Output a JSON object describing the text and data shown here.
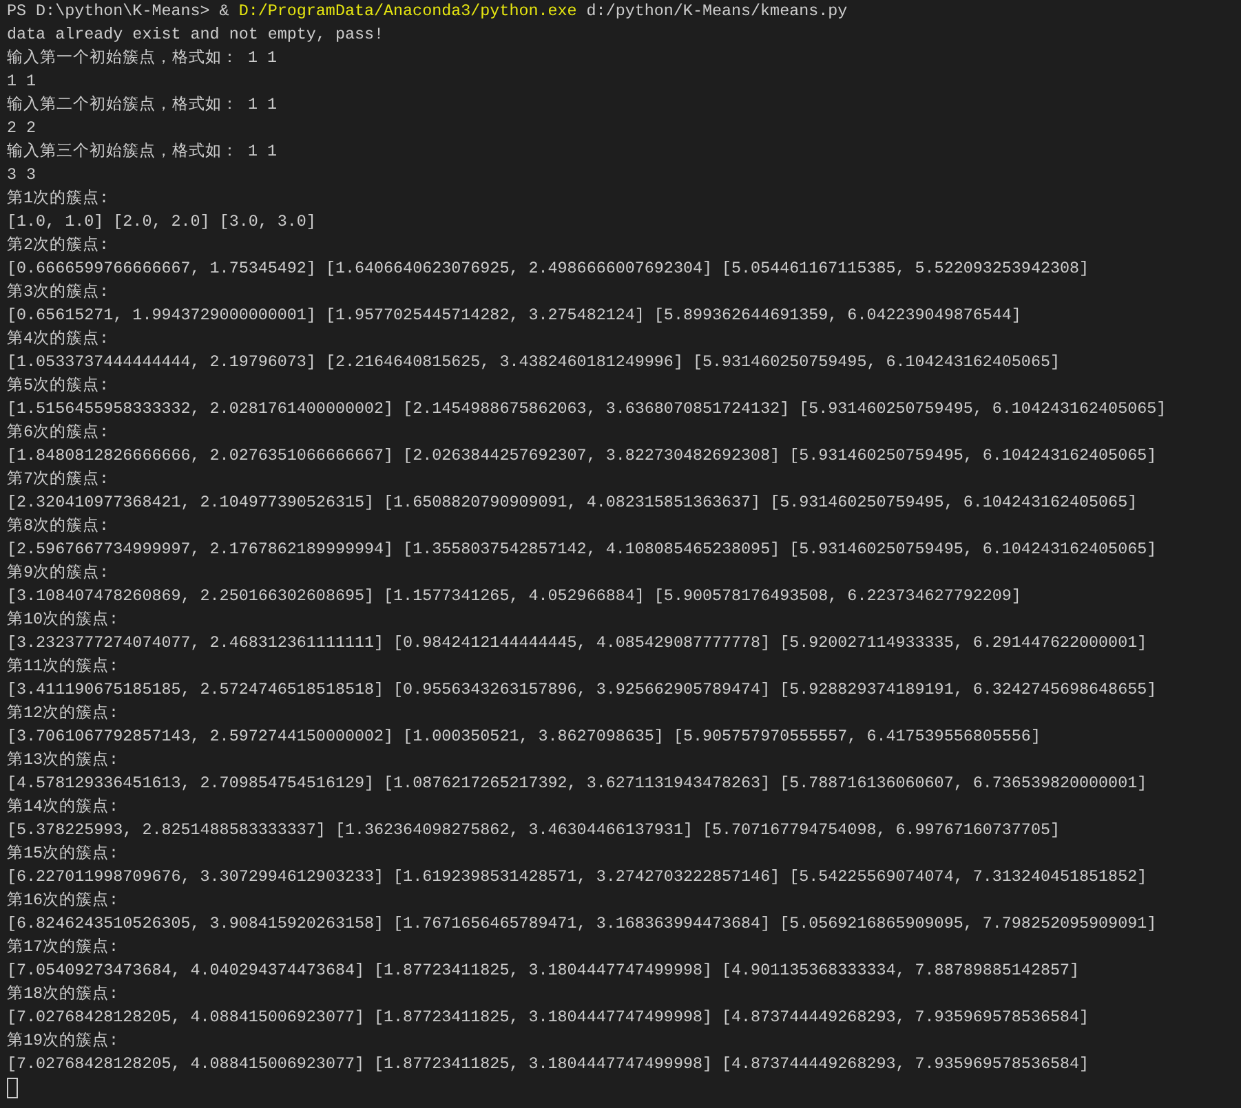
{
  "terminal": {
    "command": {
      "prompt": "PS D:\\python\\K-Means>",
      "operator": "&",
      "program": "D:/ProgramData/Anaconda3/python.exe",
      "argument": "d:/python/K-Means/kmeans.py"
    },
    "lines": [
      "data already exist and not empty, pass!",
      "输入第一个初始簇点，格式如： 1 1",
      "1 1",
      "输入第二个初始簇点，格式如： 1 1",
      "2 2",
      "输入第三个初始簇点，格式如： 1 1",
      "3 3",
      "第1次的簇点:",
      "[1.0, 1.0] [2.0, 2.0] [3.0, 3.0]",
      "第2次的簇点:",
      "[0.6666599766666667, 1.75345492] [1.6406640623076925, 2.4986666007692304] [5.054461167115385, 5.522093253942308]",
      "第3次的簇点:",
      "[0.65615271, 1.9943729000000001] [1.9577025445714282, 3.275482124] [5.899362644691359, 6.042239049876544]",
      "第4次的簇点:",
      "[1.0533737444444444, 2.19796073] [2.2164640815625, 3.4382460181249996] [5.931460250759495, 6.104243162405065]",
      "第5次的簇点:",
      "[1.5156455958333332, 2.0281761400000002] [2.1454988675862063, 3.6368070851724132] [5.931460250759495, 6.104243162405065]",
      "第6次的簇点:",
      "[1.8480812826666666, 2.0276351066666667] [2.0263844257692307, 3.822730482692308] [5.931460250759495, 6.104243162405065]",
      "第7次的簇点:",
      "[2.320410977368421, 2.104977390526315] [1.6508820790909091, 4.082315851363637] [5.931460250759495, 6.104243162405065]",
      "第8次的簇点:",
      "[2.5967667734999997, 2.1767862189999994] [1.3558037542857142, 4.108085465238095] [5.931460250759495, 6.104243162405065]",
      "第9次的簇点:",
      "[3.108407478260869, 2.250166302608695] [1.1577341265, 4.052966884] [5.900578176493508, 6.223734627792209]",
      "第10次的簇点:",
      "[3.2323777274074077, 2.468312361111111] [0.9842412144444445, 4.085429087777778] [5.920027114933335, 6.291447622000001]",
      "第11次的簇点:",
      "[3.411190675185185, 2.5724746518518518] [0.9556343263157896, 3.925662905789474] [5.928829374189191, 6.3242745698648655]",
      "第12次的簇点:",
      "[3.7061067792857143, 2.5972744150000002] [1.000350521, 3.8627098635] [5.905757970555557, 6.417539556805556]",
      "第13次的簇点:",
      "[4.578129336451613, 2.709854754516129] [1.0876217265217392, 3.6271131943478263] [5.788716136060607, 6.736539820000001]",
      "第14次的簇点:",
      "[5.378225993, 2.8251488583333337] [1.362364098275862, 3.46304466137931] [5.707167794754098, 6.99767160737705]",
      "第15次的簇点:",
      "[6.227011998709676, 3.3072994612903233] [1.6192398531428571, 3.2742703222857146] [5.54225569074074, 7.313240451851852]",
      "第16次的簇点:",
      "[6.8246243510526305, 3.908415920263158] [1.7671656465789471, 3.168363994473684] [5.0569216865909095, 7.798252095909091]",
      "第17次的簇点:",
      "[7.05409273473684, 4.040294374473684] [1.87723411825, 3.1804447747499998] [4.901135368333334, 7.88789885142857]",
      "第18次的簇点:",
      "[7.02768428128205, 4.088415006923077] [1.87723411825, 3.1804447747499998] [4.873744449268293, 7.935969578536584]",
      "第19次的簇点:",
      "[7.02768428128205, 4.088415006923077] [1.87723411825, 3.1804447747499998] [4.873744449268293, 7.935969578536584]"
    ]
  }
}
